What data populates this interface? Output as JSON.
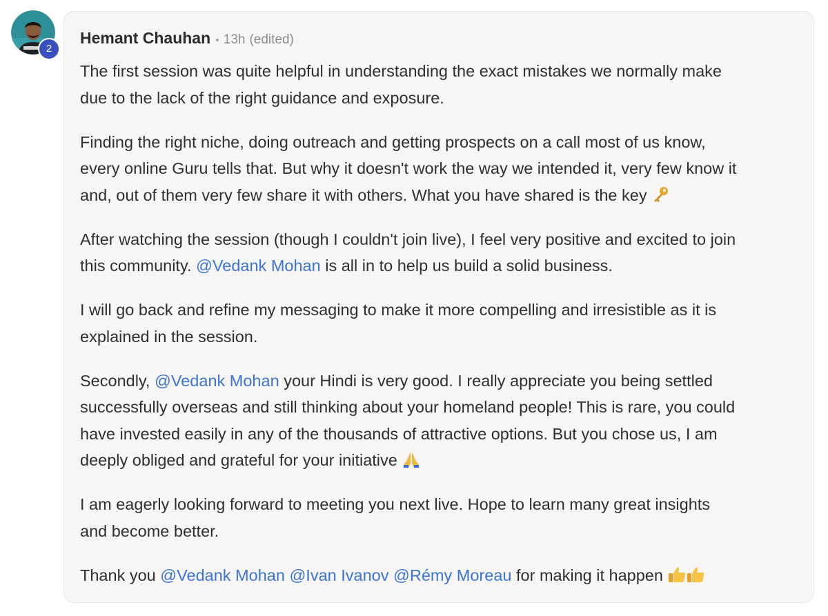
{
  "comment": {
    "author": {
      "name": "Hemant Chauhan",
      "level": "2"
    },
    "time": "13h",
    "edited_label": "(edited)",
    "separator": "•",
    "paragraphs": {
      "p1": {
        "line1": "The first session was quite helpful in understanding the exact mistakes we normally make",
        "line2": "due to the lack of the right guidance and exposure."
      },
      "p2": {
        "line1": "Finding the right niche, doing outreach and getting prospects on a call most of us know,",
        "line2": "every online Guru tells that. But why it doesn't work the way we intended it, very few know it",
        "line3": "and, out of them very few share it with others. What you have shared is the key",
        "emoji": "key-emoji"
      },
      "p3": {
        "line1": "After watching the session (though I couldn't join live), I feel very positive and excited to join",
        "line2_before": "this community.",
        "mention": "@Vedank Mohan",
        "line2_after": "is all in to help us build a solid business."
      },
      "p4": {
        "line1": "I will go back and refine my messaging to make it more compelling and irresistible as it is",
        "line2": "explained in the session."
      },
      "p5": {
        "line1_before": "Secondly,",
        "mention": "@Vedank Mohan",
        "line1_after": "your Hindi is very good. I really appreciate you being settled",
        "line2": "successfully overseas and still thinking about your homeland people! This is rare, you could",
        "line3": "have invested easily in any of the thousands of attractive options. But you chose us, I am",
        "line4": "deeply obliged and grateful for your initiative",
        "emoji": "folded-hands-emoji"
      },
      "p6": {
        "line1": "I am eagerly looking forward to meeting you next live. Hope to learn many great insights",
        "line2": "and become better."
      },
      "p7": {
        "before": "Thank you",
        "mention1": "@Vedank Mohan",
        "mention2": "@Ivan Ivanov",
        "mention3": "@Rémy Moreau",
        "after": "for making it happen",
        "emoji": "thumbs-up-emoji"
      }
    },
    "colors": {
      "bubble_bg": "#f7f6f5",
      "bubble_border": "#e6e4e1",
      "mention": "#3a74d4",
      "text": "#2f2f2f",
      "meta": "#8c8c8c",
      "level_badge": "#3a4fc0"
    }
  }
}
